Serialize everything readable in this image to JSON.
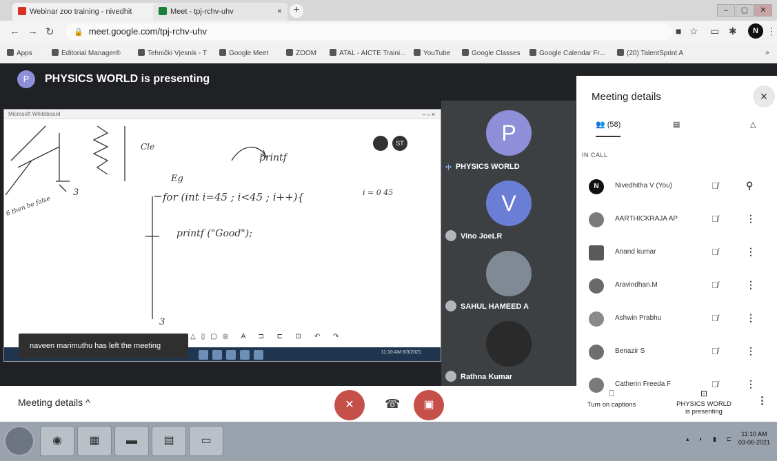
{
  "browser": {
    "tabs": [
      {
        "label": "Webinar zoo training - nivedhit",
        "close": "×"
      },
      {
        "label": "Meet - tpj-rchv-uhv",
        "close": "×"
      }
    ],
    "new_tab": "+",
    "url": "meet.google.com/tpj-rchv-uhv",
    "profile_initial": "N",
    "window_controls": [
      "–",
      "▢",
      "✕"
    ],
    "bookmarks": [
      "Apps",
      "Editorial Manager®",
      "Tehnički Vjesnik - T",
      "Google Meet",
      "ZOOM",
      "ATAL - AICTE Traini...",
      "YouTube",
      "Google Classes",
      "Google Calendar Fr...",
      "(20) TalentSprint A"
    ]
  },
  "meet": {
    "presenter_initial": "P",
    "presenting_banner": "PHYSICS WORLD is presenting",
    "shared_window_title": "Microsoft Whiteboard",
    "shared_window_controls": "–  ▫  ×",
    "whiteboard_toolbar_initials": [
      "",
      "ST"
    ],
    "whiteboard": {
      "printf": "printf",
      "label_cle": "Cle",
      "for_line": "for (int i=45 ; i<45 ; i++){",
      "printf_line": "printf (\"Good\");",
      "eg": "Eg",
      "arrow3a": "3",
      "arrow3b": "3",
      "side_note": "i = 0 45",
      "left_note": "6 then be false"
    },
    "shared_taskbar_time": "11:10 AM",
    "shared_taskbar_date": "6/3/2021",
    "toast": "naveen marimuthu has left the meeting",
    "tiles": [
      {
        "initial": "P",
        "name": "PHYSICS WORLD",
        "color": "#8e8fd8"
      },
      {
        "initial": "V",
        "name": "Vino JoeLR",
        "color": "#6b7ed6"
      },
      {
        "initial": "",
        "name": "SAHUL HAMEED A",
        "color": "#7f8a94"
      },
      {
        "initial": "",
        "name": "Rathna Kumar",
        "color": "#2a2a2a"
      }
    ],
    "bottom": {
      "meeting_details": "Meeting details",
      "chevron": "^"
    }
  },
  "panel": {
    "title": "Meeting details",
    "close": "×",
    "people_count": "(58)",
    "in_call": "IN CALL",
    "participants": [
      {
        "initial": "N",
        "name": "Nivedhitha V (You)",
        "avatar_color": "#111111"
      },
      {
        "initial": "",
        "name": "AARTHICKRAJA AP",
        "avatar_color": "#7b7b7b"
      },
      {
        "initial": "",
        "name": "Anand kumar",
        "avatar_color": "#5a5a5a"
      },
      {
        "initial": "",
        "name": "Aravindhan.M",
        "avatar_color": "#6a6a6a"
      },
      {
        "initial": "",
        "name": "Ashwin Prabhu",
        "avatar_color": "#8a8a8a"
      },
      {
        "initial": "",
        "name": "Benazir S",
        "avatar_color": "#6f6f6f"
      },
      {
        "initial": "",
        "name": "Catherin Freeda F",
        "avatar_color": "#7a7a7a"
      }
    ],
    "captions_label": "Turn on captions",
    "presenting_label_line1": "PHYSICS WORLD",
    "presenting_label_line2": "is presenting"
  },
  "taskbar": {
    "time": "11:10 AM",
    "date": "03-06-2021"
  }
}
